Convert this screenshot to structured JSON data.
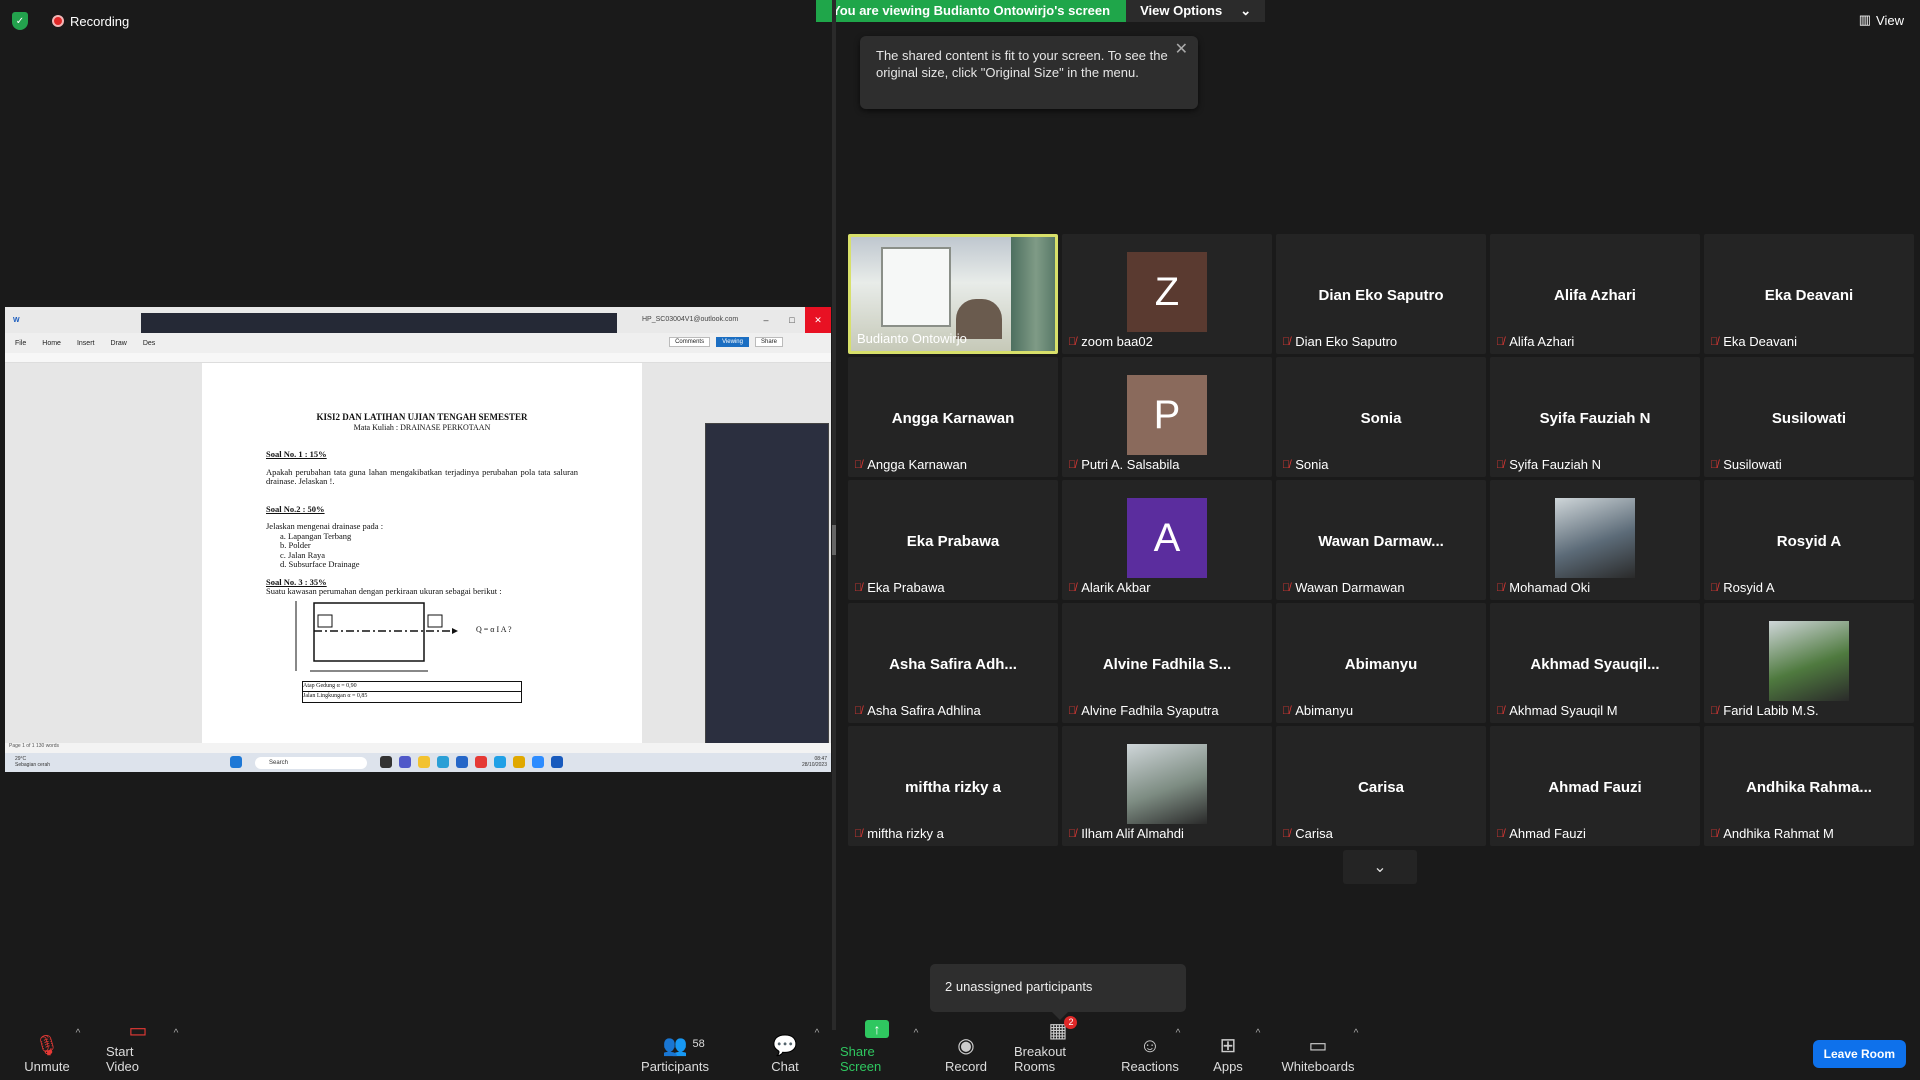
{
  "status": {
    "recording_label": "Recording"
  },
  "banner": {
    "viewing_text": "You are viewing Budianto Ontowirjo's screen",
    "view_options_label": "View Options"
  },
  "view_button": {
    "label": "View"
  },
  "tooltip": {
    "text": "The shared content is fit to your screen. To see the original size, click \"Original Size\" in the menu."
  },
  "shared_screen": {
    "word_tabs": [
      "File",
      "Home",
      "Insert",
      "Draw",
      "Des"
    ],
    "account": "HP_SC03004V1@outlook.com",
    "comments_label": "Comments",
    "viewing_label": "Viewing",
    "share_label": "Share",
    "doc": {
      "title": "KISI2 DAN LATIHAN UJIAN TENGAH SEMESTER",
      "subtitle": "Mata Kuliah :  DRAINASE PERKOTAAN",
      "q1_head": "Soal No. 1 : 15%",
      "q1_text": "Apakah perubahan tata guna lahan mengakibatkan terjadinya perubahan pola tata saluran drainase. Jelaskan !.",
      "q2_head": "Soal  No.2 : 50%",
      "q2_intro": "Jelaskan mengenai drainase pada :",
      "q2_items": [
        "a.  Lapangan Terbang",
        "b.  Polder",
        "c.  Jalan Raya",
        "d.  Subsurface Drainage"
      ],
      "q3_head": "Soal No. 3 : 35%",
      "q3_text": "Suatu kawasan perumahan dengan perkiraan ukuran sebagai berikut :",
      "formula_q": "Q = α  I  A ?",
      "table_row1": "Atap Gedung α = 0,90",
      "table_row2": "Jalan Lingkungan α = 0,85"
    },
    "status_left": "Page 1 of 1    130 words",
    "taskbar_search": "Search",
    "weather": "29°C",
    "weather_desc": "Sebagian cerah",
    "clock_time": "08:47",
    "clock_date": "28/10/2023"
  },
  "participants": [
    {
      "display": "",
      "label": "Budianto Ontowirjo",
      "type": "video",
      "active": true,
      "muted": false
    },
    {
      "display": "Z",
      "label": "zoom baa02",
      "type": "letter",
      "color": "#5a3a30",
      "muted": true
    },
    {
      "display": "Dian Eko Saputro",
      "label": "Dian Eko Saputro",
      "type": "name",
      "muted": true
    },
    {
      "display": "Alifa Azhari",
      "label": "Alifa Azhari",
      "type": "name",
      "muted": true
    },
    {
      "display": "Eka Deavani",
      "label": "Eka Deavani",
      "type": "name",
      "muted": true
    },
    {
      "display": "Angga Karnawan",
      "label": "Angga Karnawan",
      "type": "name",
      "muted": true
    },
    {
      "display": "P",
      "label": "Putri A. Salsabila",
      "type": "letter",
      "color": "#8a6a5c",
      "muted": true
    },
    {
      "display": "Sonia",
      "label": "Sonia",
      "type": "name",
      "muted": true
    },
    {
      "display": "Syifa Fauziah N",
      "label": "Syifa Fauziah N",
      "type": "name",
      "muted": true
    },
    {
      "display": "Susilowati",
      "label": "Susilowati",
      "type": "name",
      "muted": true
    },
    {
      "display": "Eka Prabawa",
      "label": "Eka Prabawa",
      "type": "name",
      "muted": true
    },
    {
      "display": "A",
      "label": "Alarik Akbar",
      "type": "letter",
      "color": "#5b2d9e",
      "muted": true
    },
    {
      "display": "Wawan  Darmaw...",
      "label": "Wawan Darmawan",
      "type": "name",
      "muted": true
    },
    {
      "display": "",
      "label": "Mohamad Oki",
      "type": "photo",
      "color": "#5c6b78",
      "muted": true
    },
    {
      "display": "Rosyid A",
      "label": "Rosyid A",
      "type": "name",
      "muted": true
    },
    {
      "display": "Asha Safira Adh...",
      "label": "Asha Safira Adhlina",
      "type": "name",
      "muted": true
    },
    {
      "display": "Alvine Fadhila S...",
      "label": "Alvine Fadhila Syaputra",
      "type": "name",
      "muted": true
    },
    {
      "display": "Abimanyu",
      "label": "Abimanyu",
      "type": "name",
      "muted": true
    },
    {
      "display": "Akhmad  Syauqil...",
      "label": "Akhmad Syauqil M",
      "type": "name",
      "muted": true
    },
    {
      "display": "",
      "label": "Farid Labib M.S.",
      "type": "photo",
      "color": "#4f7a3f",
      "muted": true
    },
    {
      "display": "miftha rizky a",
      "label": "miftha rizky a",
      "type": "name",
      "muted": true
    },
    {
      "display": "",
      "label": "Ilham Alif Almahdi",
      "type": "photo",
      "color": "#7d8c82",
      "muted": true
    },
    {
      "display": "Carisa",
      "label": "Carisa",
      "type": "name",
      "muted": true
    },
    {
      "display": "Ahmad Fauzi",
      "label": "Ahmad Fauzi",
      "type": "name",
      "muted": true
    },
    {
      "display": "Andhika  Rahma...",
      "label": "Andhika Rahmat M",
      "type": "name",
      "muted": true
    }
  ],
  "unassigned_text": "2 unassigned participants",
  "toolbar": {
    "unmute": "Unmute",
    "start_video": "Start Video",
    "participants": "Participants",
    "participants_count": "58",
    "chat": "Chat",
    "share_screen": "Share Screen",
    "record": "Record",
    "breakout_rooms": "Breakout Rooms",
    "breakout_badge": "2",
    "reactions": "Reactions",
    "apps": "Apps",
    "whiteboards": "Whiteboards",
    "leave_room": "Leave Room"
  },
  "colors": {
    "green": "#1fa64a",
    "leave_blue": "#0e71eb",
    "muted_red": "#e53935",
    "active_border": "#d8e06a"
  }
}
